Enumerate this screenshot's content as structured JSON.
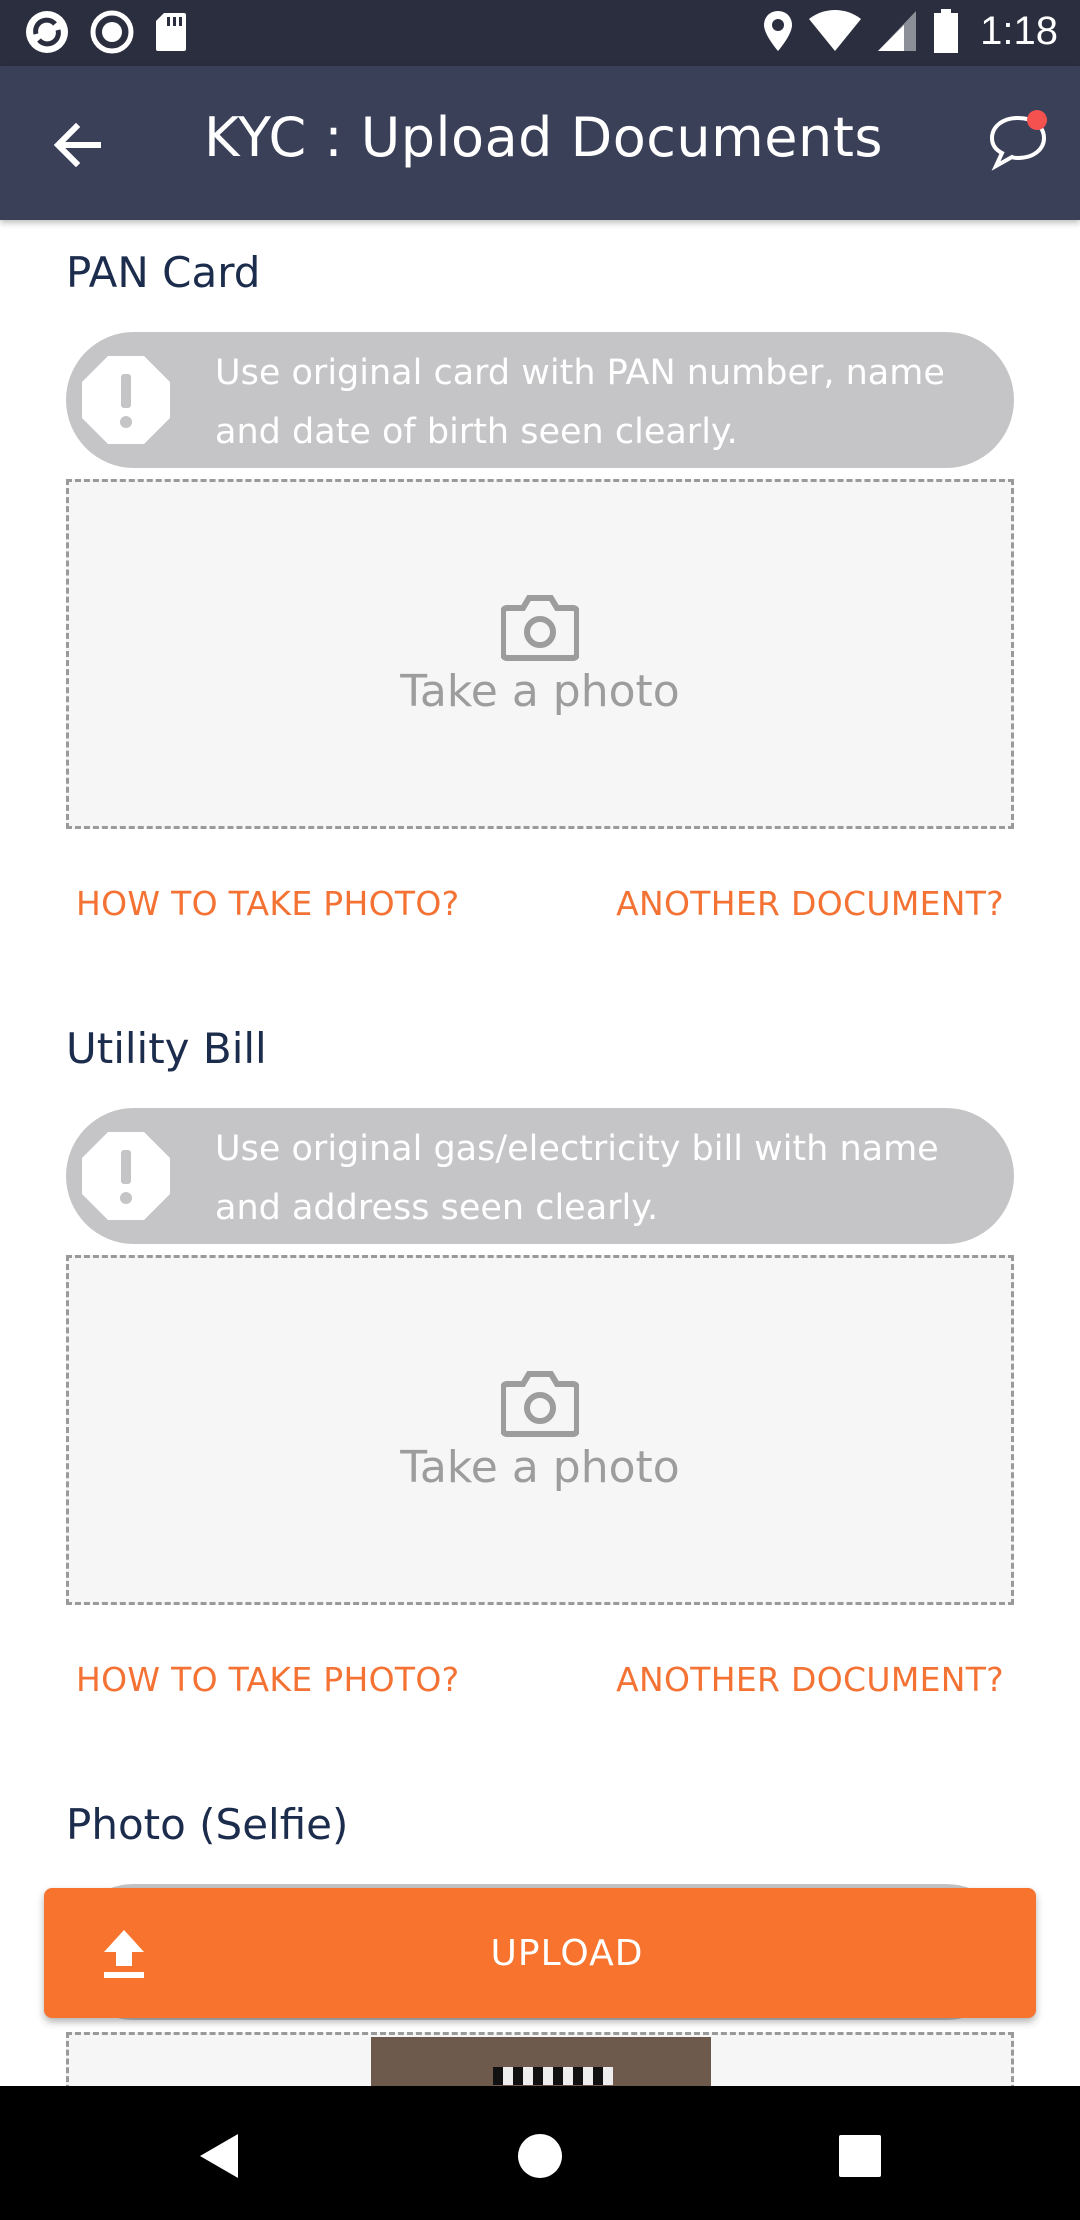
{
  "status_bar": {
    "time": "1:18",
    "icons": [
      "sync-icon",
      "record-icon",
      "sd-card-icon",
      "location-icon",
      "wifi-icon",
      "signal-icon",
      "battery-icon"
    ]
  },
  "app_bar": {
    "title": "KYC : Upload Documents",
    "back_icon": "arrow-left-icon",
    "chat_icon": "chat-bubble-icon",
    "notification_dot_color": "#f4514f"
  },
  "sections": [
    {
      "title": "PAN Card",
      "note": "Use original card with PAN number, name and date of birth seen clearly.",
      "photo_label": "Take a photo",
      "how_to_link": "HOW TO TAKE PHOTO?",
      "another_link": "ANOTHER DOCUMENT?"
    },
    {
      "title": "Utility Bill",
      "note": "Use original gas/electricity bill with name and address seen clearly.",
      "photo_label": "Take a photo",
      "how_to_link": "HOW TO TAKE PHOTO?",
      "another_link": "ANOTHER DOCUMENT?"
    },
    {
      "title": "Photo (Selfie)"
    }
  ],
  "upload_button": {
    "label": "UPLOAD",
    "icon": "upload-icon"
  },
  "nav_bar": {
    "icons": [
      "back-triangle-icon",
      "home-circle-icon",
      "recents-square-icon"
    ]
  },
  "colors": {
    "accent": "#f7732e",
    "header": "#3a4058",
    "status_bar": "#2a2e3e",
    "title_text": "#1c2c4c",
    "note_bg": "#c5c4c6"
  }
}
